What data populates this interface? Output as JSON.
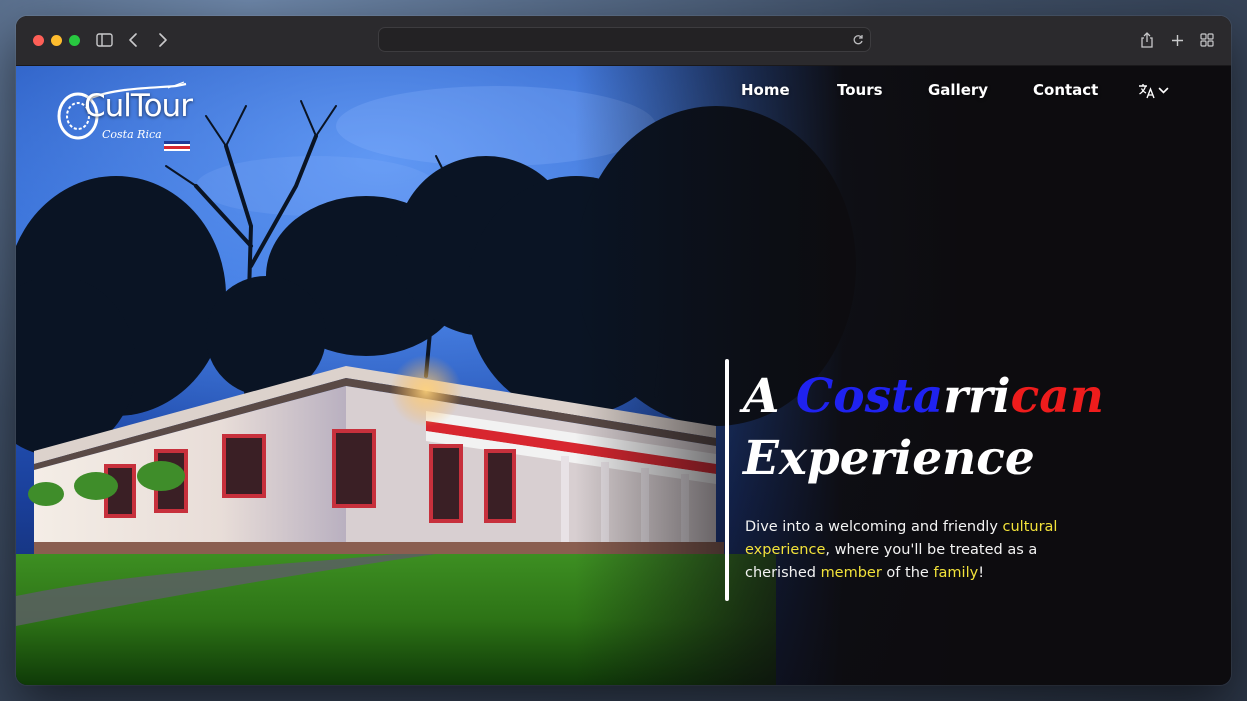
{
  "browser": {
    "controls": {
      "close_color": "#fe5f57",
      "minimize_color": "#febc2e",
      "zoom_color": "#28c840"
    },
    "icons": [
      "sidebar-toggle-icon",
      "back-icon",
      "forward-icon",
      "reload-icon",
      "share-icon",
      "new-tab-icon",
      "tab-overview-icon"
    ]
  },
  "site": {
    "logo": {
      "name": "CulTour",
      "sub": "Costa Rica"
    },
    "nav": {
      "items": [
        {
          "label": "Home"
        },
        {
          "label": "Tours"
        },
        {
          "label": "Gallery"
        },
        {
          "label": "Contact"
        }
      ],
      "language_icon": "translate-icon",
      "dropdown_icon": "chevron-down-icon"
    },
    "hero": {
      "headline": {
        "prefix": "A ",
        "word_part_1": "Costa",
        "word_part_2": "rri",
        "word_part_3": "can",
        "line_2": "Experience"
      },
      "lead": {
        "part_1": "Dive into a welcoming and friendly ",
        "highlight_1": "cultural experience",
        "part_2": ", where you'll be treated as a cherished ",
        "highlight_2": "member",
        "part_3": " of the ",
        "highlight_3": "family",
        "part_4": "!"
      },
      "colors": {
        "blue": "#1f22f0",
        "red": "#ee1c1c",
        "highlight": "#f2e23a",
        "background": "#0d0c0f"
      }
    }
  }
}
